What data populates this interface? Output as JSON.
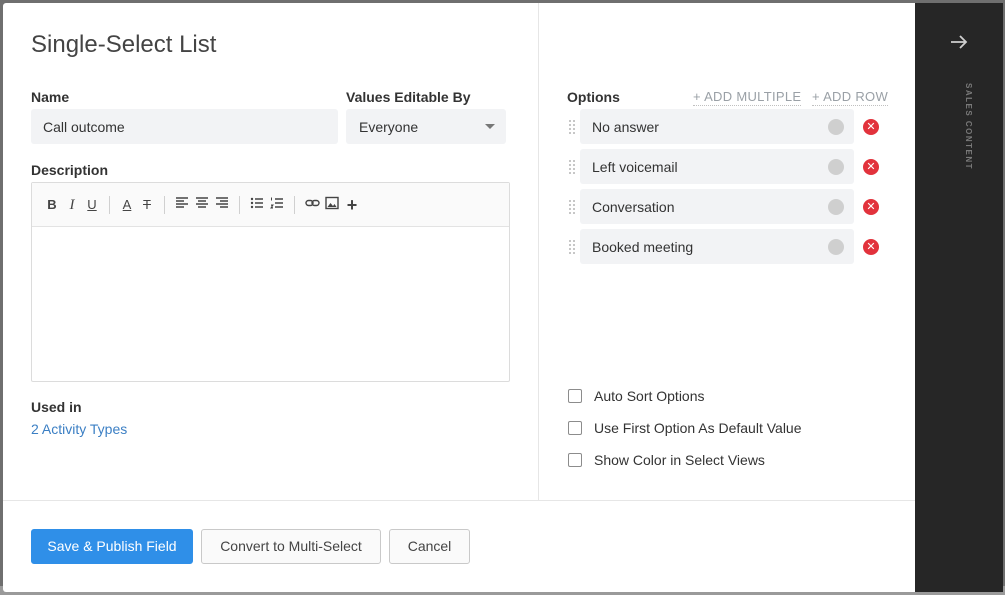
{
  "dialog": {
    "title": "Single-Select List"
  },
  "name_field": {
    "label": "Name",
    "value": "Call outcome"
  },
  "editable_by": {
    "label": "Values Editable By",
    "selected": "Everyone"
  },
  "description": {
    "label": "Description",
    "toolbar": [
      {
        "icon": "bold-icon",
        "glyph": "B"
      },
      {
        "icon": "italic-icon",
        "glyph": "I"
      },
      {
        "icon": "underline-icon",
        "glyph": "U"
      },
      {
        "icon": "text-color-icon",
        "glyph": "A"
      },
      {
        "icon": "clear-format-icon",
        "glyph": "T"
      },
      {
        "icon": "align-left-icon"
      },
      {
        "icon": "align-center-icon"
      },
      {
        "icon": "align-right-icon"
      },
      {
        "icon": "bullet-list-icon"
      },
      {
        "icon": "numbered-list-icon"
      },
      {
        "icon": "link-icon"
      },
      {
        "icon": "image-icon"
      },
      {
        "icon": "plus-icon",
        "glyph": "+"
      }
    ],
    "content": ""
  },
  "used_in": {
    "label": "Used in",
    "link": "2 Activity Types"
  },
  "options": {
    "label": "Options",
    "add_multiple": "+ ADD MULTIPLE",
    "add_row": "+ ADD ROW",
    "items": [
      {
        "label": "No answer"
      },
      {
        "label": "Left voicemail"
      },
      {
        "label": "Conversation"
      },
      {
        "label": "Booked meeting"
      }
    ]
  },
  "settings": {
    "auto_sort": {
      "label": "Auto Sort Options",
      "checked": false
    },
    "first_default": {
      "label": "Use First Option As Default Value",
      "checked": false
    },
    "show_color": {
      "label": "Show Color in Select Views",
      "checked": false
    }
  },
  "footer": {
    "save_label": "Save & Publish Field",
    "convert_label": "Convert to Multi-Select",
    "cancel_label": "Cancel"
  },
  "side_rail": {
    "label": "SALES CONTENT"
  },
  "colors": {
    "primary": "#2f8fe8",
    "remove": "#e2323c",
    "link": "#3b7fc4",
    "rail": "#262626"
  }
}
